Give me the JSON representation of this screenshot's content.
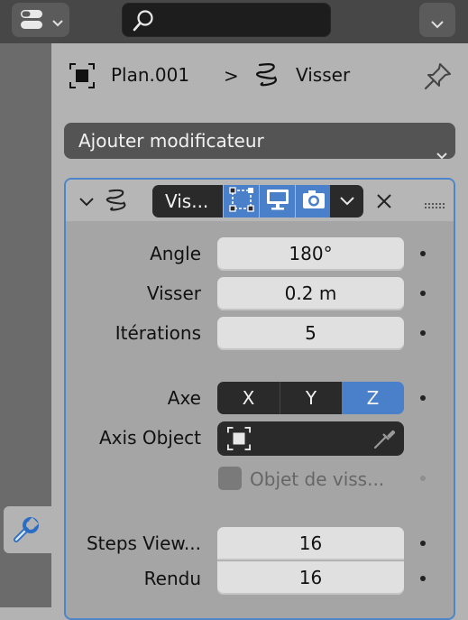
{
  "header": {
    "object_name": "Plan.001",
    "breadcrumb_sep": ">",
    "modifier_name": "Visser"
  },
  "add_modifier": {
    "label": "Ajouter modificateur"
  },
  "modifier": {
    "name_field": "Vis...",
    "fields": {
      "angle": {
        "label": "Angle",
        "value": "180°"
      },
      "screw": {
        "label": "Visser",
        "value": "0.2 m"
      },
      "iterations": {
        "label": "Itérations",
        "value": "5"
      },
      "axis": {
        "label": "Axe",
        "options": [
          "X",
          "Y",
          "Z"
        ],
        "selected": "Z"
      },
      "axis_object": {
        "label": "Axis Object",
        "value": ""
      },
      "screw_offset": {
        "label": "Objet de viss...",
        "checked": false
      },
      "steps_viewport": {
        "label": "Steps View...",
        "value": "16"
      },
      "render": {
        "label": "Rendu",
        "value": "16"
      }
    }
  },
  "colors": {
    "accent": "#4a80c9",
    "panel_border": "#4c85c9",
    "dark_field": "#2a2a2a"
  }
}
